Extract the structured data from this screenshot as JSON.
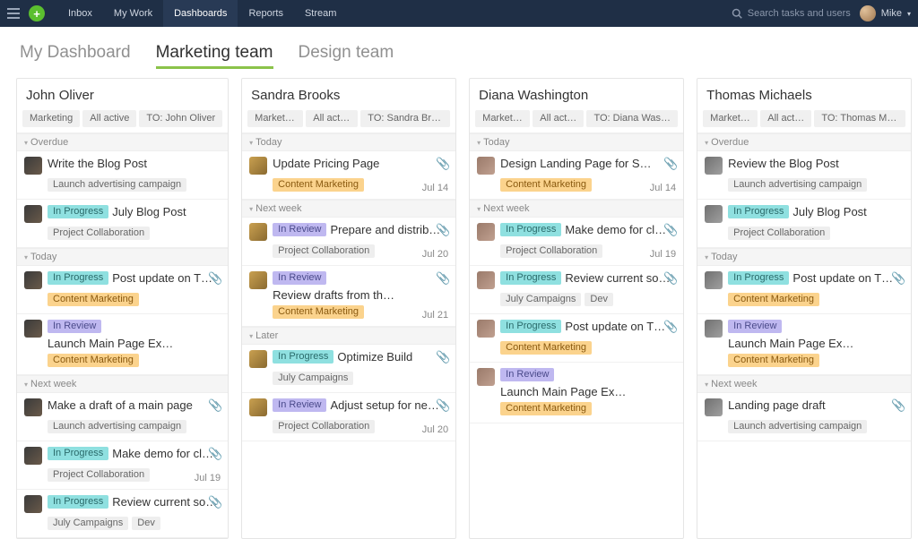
{
  "nav": {
    "items": [
      "Inbox",
      "My Work",
      "Dashboards",
      "Reports",
      "Stream"
    ],
    "active_index": 2,
    "search_placeholder": "Search tasks and users",
    "user_name": "Mike"
  },
  "dash_tabs": {
    "items": [
      "My Dashboard",
      "Marketing team",
      "Design team"
    ],
    "active_index": 1
  },
  "columns": [
    {
      "name": "John Oliver",
      "avatar_class": "av-jo",
      "filters": [
        "Marketing",
        "All active",
        "TO: John Oliver"
      ],
      "sections": [
        {
          "label": "Overdue",
          "tasks": [
            {
              "title": "Write the Blog Post",
              "status": null,
              "tags": [
                "Launch advertising campaign"
              ],
              "attach": false,
              "date": null
            },
            {
              "title": "July Blog Post",
              "status": "In Progress",
              "status_kind": "progress",
              "tags": [
                "Project Collaboration"
              ],
              "attach": false,
              "date": null
            }
          ]
        },
        {
          "label": "Today",
          "tasks": [
            {
              "title": "Post update on T…",
              "status": "In Progress",
              "status_kind": "progress",
              "tags": [
                "Content Marketing"
              ],
              "tag_cm": true,
              "attach": true,
              "date": null
            },
            {
              "title": "Launch Main Page Ex…",
              "status": "In Review",
              "status_kind": "review",
              "tags": [
                "Content Marketing"
              ],
              "tag_cm": true,
              "attach": false,
              "date": null
            }
          ]
        },
        {
          "label": "Next week",
          "tasks": [
            {
              "title": "Make a draft of a main page",
              "status": null,
              "tags": [
                "Launch advertising campaign"
              ],
              "attach": true,
              "date": null
            },
            {
              "title": "Make demo for cl…",
              "status": "In Progress",
              "status_kind": "progress",
              "tags": [
                "Project Collaboration"
              ],
              "attach": true,
              "date": "Jul 19"
            },
            {
              "title": "Review current so…",
              "status": "In Progress",
              "status_kind": "progress",
              "tags": [
                "July Campaigns",
                "Dev"
              ],
              "attach": true,
              "date": null
            }
          ]
        }
      ]
    },
    {
      "name": "Sandra Brooks",
      "avatar_class": "av-sb",
      "filters": [
        "Marketing",
        "All active",
        "TO: Sandra Bro…"
      ],
      "sections": [
        {
          "label": "Today",
          "tasks": [
            {
              "title": "Update Pricing Page",
              "status": null,
              "tags": [
                "Content Marketing"
              ],
              "tag_cm": true,
              "attach": true,
              "date": "Jul 14"
            }
          ]
        },
        {
          "label": "Next week",
          "tasks": [
            {
              "title": "Prepare and distrib…",
              "status": "In Review",
              "status_kind": "review",
              "tags": [
                "Project Collaboration"
              ],
              "attach": true,
              "date": "Jul 20"
            },
            {
              "title": "Review drafts from th…",
              "status": "In Review",
              "status_kind": "review",
              "tags": [
                "Content Marketing"
              ],
              "tag_cm": true,
              "attach": true,
              "date": "Jul 21"
            }
          ]
        },
        {
          "label": "Later",
          "tasks": [
            {
              "title": "Optimize Build",
              "status": "In Progress",
              "status_kind": "progress",
              "tags": [
                "July Campaigns"
              ],
              "attach": true,
              "date": null
            },
            {
              "title": "Adjust setup for ne…",
              "status": "In Review",
              "status_kind": "review",
              "tags": [
                "Project Collaboration"
              ],
              "attach": true,
              "date": "Jul 20"
            }
          ]
        }
      ]
    },
    {
      "name": "Diana Washington",
      "avatar_class": "av-dw",
      "filters": [
        "Marketing",
        "All active",
        "TO: Diana Wash…"
      ],
      "sections": [
        {
          "label": "Today",
          "tasks": [
            {
              "title": "Design Landing Page for Sum…",
              "status": null,
              "tags": [
                "Content Marketing"
              ],
              "tag_cm": true,
              "attach": true,
              "date": "Jul 14"
            }
          ]
        },
        {
          "label": "Next week",
          "tasks": [
            {
              "title": "Make demo for cl…",
              "status": "In Progress",
              "status_kind": "progress",
              "tags": [
                "Project Collaboration"
              ],
              "attach": true,
              "date": "Jul 19"
            },
            {
              "title": "Review current so…",
              "status": "In Progress",
              "status_kind": "progress",
              "tags": [
                "July Campaigns",
                "Dev"
              ],
              "attach": true,
              "date": null
            },
            {
              "title": "Post update on T…",
              "status": "In Progress",
              "status_kind": "progress",
              "tags": [
                "Content Marketing"
              ],
              "tag_cm": true,
              "attach": true,
              "date": null
            },
            {
              "title": "Launch Main Page Ex…",
              "status": "In Review",
              "status_kind": "review",
              "tags": [
                "Content Marketing"
              ],
              "tag_cm": true,
              "attach": false,
              "date": null
            }
          ]
        }
      ]
    },
    {
      "name": "Thomas Michaels",
      "avatar_class": "av-tm",
      "filters": [
        "Marketing",
        "All active",
        "TO: Thomas Mic…"
      ],
      "sections": [
        {
          "label": "Overdue",
          "tasks": [
            {
              "title": "Review the Blog Post",
              "status": null,
              "tags": [
                "Launch advertising campaign"
              ],
              "attach": false,
              "date": null
            },
            {
              "title": "July Blog Post",
              "status": "In Progress",
              "status_kind": "progress",
              "tags": [
                "Project Collaboration"
              ],
              "attach": false,
              "date": null
            }
          ]
        },
        {
          "label": "Today",
          "tasks": [
            {
              "title": "Post update on T…",
              "status": "In Progress",
              "status_kind": "progress",
              "tags": [
                "Content Marketing"
              ],
              "tag_cm": true,
              "attach": true,
              "date": null
            },
            {
              "title": "Launch Main Page Ex…",
              "status": "In Review",
              "status_kind": "review",
              "tags": [
                "Content Marketing"
              ],
              "tag_cm": true,
              "attach": false,
              "date": null
            }
          ]
        },
        {
          "label": "Next week",
          "tasks": [
            {
              "title": "Landing page draft",
              "status": null,
              "tags": [
                "Launch advertising campaign"
              ],
              "attach": true,
              "date": null
            }
          ]
        }
      ]
    }
  ]
}
